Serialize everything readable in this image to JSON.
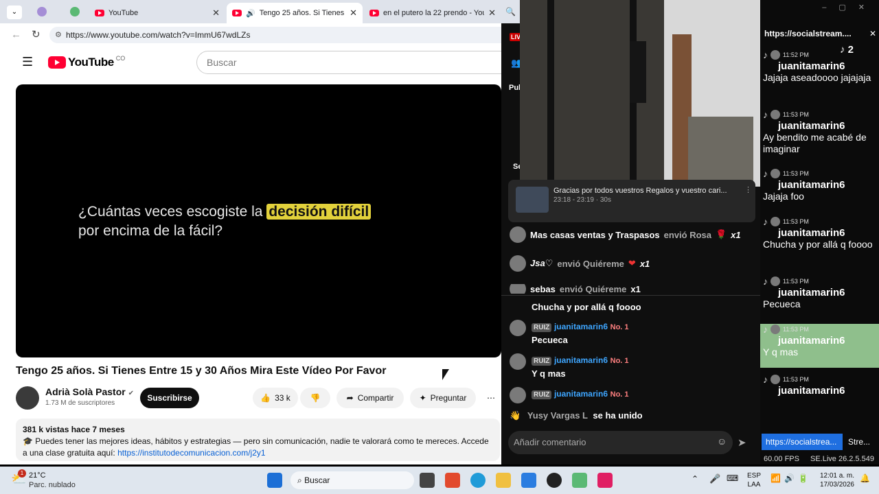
{
  "browser": {
    "tabs": [
      {
        "label": "YouTube"
      },
      {
        "label": "Tengo 25 años. Si Tienes Entre"
      },
      {
        "label": "en el putero la 22 prendo - YouTub"
      }
    ],
    "url": "https://www.youtube.com/watch?v=ImmU67wdLZs"
  },
  "youtube": {
    "logo_text": "YouTube",
    "region": "CO",
    "search_placeholder": "Buscar",
    "video_text_pre": "¿Cuántas veces escogiste la",
    "video_text_hl": "decisión difícil",
    "video_text_line2": "por encima de la fácil?",
    "title": "Tengo 25 años. Si Tienes Entre 15 y 30 Años Mira Este Vídeo Por Favor",
    "channel": "Adrià Solà Pastor",
    "subs": "1.73 M de suscriptores",
    "subscribe": "Suscribirse",
    "likes": "33 k",
    "share": "Compartir",
    "ask": "Preguntar",
    "views": "381 k vistas  hace 7 meses",
    "desc": "🎓 Puedes tener las mejores ideas, hábitos y estrategias — pero sin comunicación, nadie te valorará como te mereces. Accede a una clase gratuita aquí:",
    "desc_link": "https://institutodecomunicacion.com/j2y1"
  },
  "ytchat": {
    "live": "LIV",
    "pul": "Pul",
    "se": "Se",
    "pinned_title": "Gracias por todos vuestros Regalos y vuestro cari...",
    "pinned_time": "23:18 - 23:19 · 30s",
    "gifts": [
      {
        "name": "Mas casas ventas y Traspasos",
        "action": "envió Rosa",
        "count": "x1"
      },
      {
        "name": "Jsa♡",
        "action": "envió Quiéreme",
        "count": "x1"
      },
      {
        "name": "sebas",
        "action": "envió Quiéreme",
        "count": "x1"
      }
    ],
    "msg_prev": "Chucha y por allá q foooo",
    "messages": [
      {
        "badge": "RUIZ",
        "user": "juanitamarin6",
        "rank": "No. 1",
        "text": "Pecueca"
      },
      {
        "badge": "RUIZ",
        "user": "juanitamarin6",
        "rank": "No. 1",
        "text": "Y q mas"
      },
      {
        "badge": "RUIZ",
        "user": "juanitamarin6",
        "rank": "No. 1",
        "text": ""
      }
    ],
    "joined_user": "Yusy Vargas L",
    "joined_text": "se ha unido",
    "comment_placeholder": "Añadir comentario"
  },
  "tiktok": {
    "header": "https://socialstream....",
    "viewers": "2",
    "messages": [
      {
        "time": "11:52 PM",
        "user": "juanitamarin6",
        "text": "Jajaja aseadoooo jajajaja"
      },
      {
        "time": "11:53 PM",
        "user": "juanitamarin6",
        "text": "Ay bendito me acabé de imaginar"
      },
      {
        "time": "11:53 PM",
        "user": "juanitamarin6",
        "text": "Jajaja foo"
      },
      {
        "time": "11:53 PM",
        "user": "juanitamarin6",
        "text": "Chucha y por allá q foooo"
      },
      {
        "time": "11:53 PM",
        "user": "juanitamarin6",
        "text": "Pecueca"
      },
      {
        "time": "11:53 PM",
        "user": "juanitamarin6",
        "text": "Y q mas"
      },
      {
        "time": "11:53 PM",
        "user": "juanitamarin6",
        "text": ""
      }
    ],
    "footer_link": "https://socialstrea...",
    "footer_other": "Stre...",
    "fps": "60.00 FPS",
    "version": "SE.Live 26.2.5.549"
  },
  "taskbar": {
    "temp": "21°C",
    "weather": "Parc. nublado",
    "search": "Buscar",
    "lang1": "ESP",
    "lang2": "LAA",
    "time": "12:01 a. m.",
    "date": "17/03/2026",
    "notif": "1"
  }
}
